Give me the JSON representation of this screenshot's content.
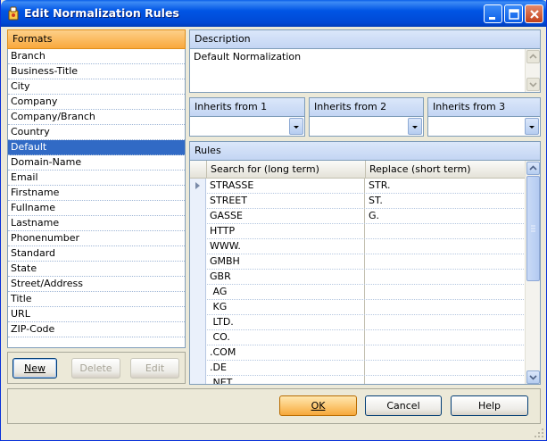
{
  "window": {
    "title": "Edit Normalization Rules"
  },
  "formats": {
    "header": "Formats",
    "items": [
      {
        "label": "Branch"
      },
      {
        "label": "Business-Title"
      },
      {
        "label": "City"
      },
      {
        "label": "Company"
      },
      {
        "label": "Company/Branch"
      },
      {
        "label": "Country"
      },
      {
        "label": "Default",
        "selected": true
      },
      {
        "label": "Domain-Name"
      },
      {
        "label": "Email"
      },
      {
        "label": "Firstname"
      },
      {
        "label": "Fullname"
      },
      {
        "label": "Lastname"
      },
      {
        "label": "Phonenumber"
      },
      {
        "label": "Standard"
      },
      {
        "label": "State"
      },
      {
        "label": "Street/Address"
      },
      {
        "label": "Title"
      },
      {
        "label": "URL"
      },
      {
        "label": "ZIP-Code"
      }
    ],
    "buttons": {
      "new": "New",
      "delete": "Delete",
      "edit": "Edit"
    }
  },
  "description": {
    "header": "Description",
    "value": "Default Normalization"
  },
  "inherits": [
    {
      "label": "Inherits from 1",
      "value": ""
    },
    {
      "label": "Inherits from 2",
      "value": ""
    },
    {
      "label": "Inherits from 3",
      "value": ""
    }
  ],
  "rules": {
    "header": "Rules",
    "columns": [
      "Search for (long term)",
      "Replace (short term)"
    ],
    "rows": [
      {
        "search": "STRASSE",
        "replace": "STR."
      },
      {
        "search": "STREET",
        "replace": "ST."
      },
      {
        "search": "GASSE",
        "replace": "G."
      },
      {
        "search": "HTTP",
        "replace": ""
      },
      {
        "search": "WWW.",
        "replace": ""
      },
      {
        "search": "GMBH",
        "replace": ""
      },
      {
        "search": "GBR",
        "replace": ""
      },
      {
        "search": " AG",
        "replace": ""
      },
      {
        "search": " KG",
        "replace": ""
      },
      {
        "search": " LTD.",
        "replace": ""
      },
      {
        "search": " CO.",
        "replace": ""
      },
      {
        "search": ".COM",
        "replace": ""
      },
      {
        "search": ".DE",
        "replace": ""
      },
      {
        "search": ".NET",
        "replace": ""
      }
    ]
  },
  "dialog_buttons": {
    "ok": "OK",
    "cancel": "Cancel",
    "help": "Help"
  },
  "colors": {
    "titlebar": "#0055e5",
    "formats_header": "#f9a83c",
    "selection": "#316ac5",
    "panel_header": "#c3d5f3"
  }
}
